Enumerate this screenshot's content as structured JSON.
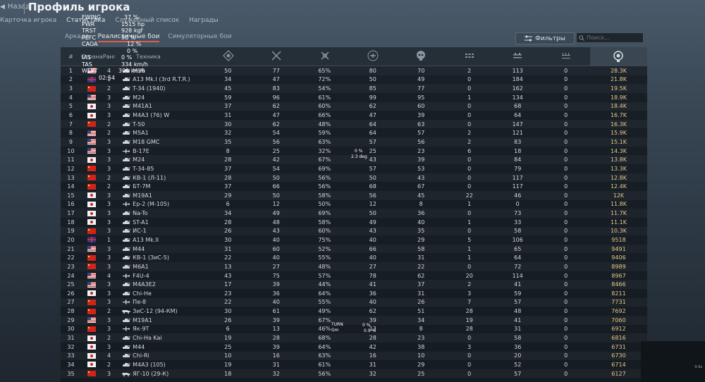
{
  "header": {
    "back_label": "Назад",
    "title": "Профиль игрока"
  },
  "tabs_main": [
    {
      "label": "Карточка игрока",
      "active": false
    },
    {
      "label": "Статистика",
      "active": true
    },
    {
      "label": "Служебный список",
      "active": false
    },
    {
      "label": "Награды",
      "active": false
    }
  ],
  "tabs_mode": [
    {
      "label": "Аркада",
      "active": false
    },
    {
      "label": "Реалистичные бои",
      "active": true
    },
    {
      "label": "Симуляторные бои",
      "active": false
    }
  ],
  "toolbar": {
    "filter_label": "Фильтры",
    "search_placeholder": "Поиск..."
  },
  "table": {
    "headers": {
      "num": "#",
      "country": "Страна",
      "rank": "Ранг",
      "vehicle": "Техника"
    },
    "stat_icons": [
      "battles-icon",
      "victories-icon",
      "win-rate-icon",
      "air-kills-icon",
      "ground-kills-icon",
      "stat6-icon",
      "stat7-icon",
      "stat8-icon",
      "research-icon"
    ],
    "rows": [
      {
        "n": "1",
        "c": "usa",
        "r": "4",
        "v": "M36",
        "t": "tank",
        "s": [
          "50",
          "77",
          "65%",
          "80",
          "70",
          "2",
          "113",
          "0",
          "28.3K"
        ]
      },
      {
        "n": "2",
        "c": "uk",
        "r": "1",
        "v": "A13 Mk.I (3rd R.T.R.)",
        "t": "tank",
        "s": [
          "34",
          "47",
          "72%",
          "50",
          "49",
          "0",
          "184",
          "0",
          "21.8K"
        ]
      },
      {
        "n": "3",
        "c": "china",
        "r": "2",
        "v": "T-34 (1940)",
        "t": "tank",
        "s": [
          "45",
          "83",
          "54%",
          "85",
          "77",
          "0",
          "162",
          "0",
          "19.5K"
        ]
      },
      {
        "n": "4",
        "c": "usa",
        "r": "3",
        "v": "M24",
        "t": "tank",
        "s": [
          "59",
          "96",
          "61%",
          "99",
          "95",
          "1",
          "134",
          "0",
          "18.9K"
        ]
      },
      {
        "n": "5",
        "c": "japan",
        "r": "3",
        "v": "M41A1",
        "t": "tank",
        "s": [
          "37",
          "62",
          "60%",
          "62",
          "60",
          "0",
          "68",
          "0",
          "18.4K"
        ]
      },
      {
        "n": "6",
        "c": "japan",
        "r": "3",
        "v": "M4A3 (76) W",
        "t": "tank",
        "s": [
          "31",
          "47",
          "66%",
          "47",
          "39",
          "0",
          "64",
          "0",
          "16.7K"
        ]
      },
      {
        "n": "7",
        "c": "china",
        "r": "2",
        "v": "T-50",
        "t": "tank",
        "s": [
          "30",
          "62",
          "48%",
          "64",
          "63",
          "0",
          "147",
          "0",
          "16.3K"
        ]
      },
      {
        "n": "8",
        "c": "usa",
        "r": "2",
        "v": "M5A1",
        "t": "tank",
        "s": [
          "32",
          "54",
          "59%",
          "64",
          "57",
          "2",
          "121",
          "0",
          "15.9K"
        ]
      },
      {
        "n": "9",
        "c": "usa",
        "r": "3",
        "v": "M18 GMC",
        "t": "tank",
        "s": [
          "35",
          "56",
          "63%",
          "57",
          "56",
          "2",
          "83",
          "0",
          "15.1K"
        ]
      },
      {
        "n": "10",
        "c": "usa",
        "r": "3",
        "v": "B-17E",
        "t": "plane",
        "s": [
          "8",
          "25",
          "32%",
          "25",
          "23",
          "6",
          "18",
          "0",
          "14.3K"
        ]
      },
      {
        "n": "11",
        "c": "japan",
        "r": "3",
        "v": "M24",
        "t": "tank",
        "s": [
          "28",
          "42",
          "67%",
          "43",
          "39",
          "0",
          "84",
          "0",
          "13.8K"
        ]
      },
      {
        "n": "12",
        "c": "china",
        "r": "3",
        "v": "T-34-85",
        "t": "tank",
        "s": [
          "37",
          "54",
          "69%",
          "57",
          "53",
          "0",
          "79",
          "0",
          "13.3K"
        ]
      },
      {
        "n": "13",
        "c": "china",
        "r": "2",
        "v": "КВ-1 (Л-11)",
        "t": "tank",
        "s": [
          "28",
          "50",
          "56%",
          "50",
          "43",
          "0",
          "117",
          "0",
          "12.8K"
        ]
      },
      {
        "n": "14",
        "c": "china",
        "r": "2",
        "v": "БТ-7М",
        "t": "tank",
        "s": [
          "37",
          "66",
          "56%",
          "68",
          "67",
          "0",
          "117",
          "0",
          "12.4K"
        ]
      },
      {
        "n": "15",
        "c": "japan",
        "r": "3",
        "v": "M19A1",
        "t": "tank",
        "s": [
          "29",
          "50",
          "58%",
          "56",
          "45",
          "22",
          "46",
          "0",
          "12K"
        ]
      },
      {
        "n": "16",
        "c": "japan",
        "r": "3",
        "v": "Ep-2 (M-105)",
        "t": "plane",
        "s": [
          "6",
          "12",
          "50%",
          "12",
          "8",
          "1",
          "0",
          "0",
          "11.8K"
        ]
      },
      {
        "n": "17",
        "c": "japan",
        "r": "3",
        "v": "Na-To",
        "t": "tank",
        "s": [
          "34",
          "49",
          "69%",
          "50",
          "36",
          "0",
          "73",
          "0",
          "11.7K"
        ]
      },
      {
        "n": "18",
        "c": "japan",
        "r": "3",
        "v": "ST-A1",
        "t": "tank",
        "s": [
          "28",
          "48",
          "58%",
          "49",
          "40",
          "1",
          "33",
          "0",
          "11.1K"
        ]
      },
      {
        "n": "19",
        "c": "china",
        "r": "3",
        "v": "ИС-1",
        "t": "tank",
        "s": [
          "26",
          "43",
          "60%",
          "43",
          "35",
          "0",
          "58",
          "0",
          "10.3K"
        ]
      },
      {
        "n": "20",
        "c": "uk",
        "r": "1",
        "v": "A13 Mk.II",
        "t": "tank",
        "s": [
          "30",
          "40",
          "75%",
          "40",
          "29",
          "5",
          "106",
          "0",
          "9518"
        ]
      },
      {
        "n": "21",
        "c": "usa",
        "r": "3",
        "v": "M44",
        "t": "tank",
        "s": [
          "31",
          "60",
          "52%",
          "66",
          "58",
          "1",
          "65",
          "0",
          "9491"
        ]
      },
      {
        "n": "22",
        "c": "china",
        "r": "3",
        "v": "КВ-1 (ЗиС-5)",
        "t": "tank",
        "s": [
          "22",
          "40",
          "55%",
          "40",
          "31",
          "1",
          "64",
          "0",
          "9406"
        ]
      },
      {
        "n": "23",
        "c": "china",
        "r": "3",
        "v": "M6A1",
        "t": "tank",
        "s": [
          "13",
          "27",
          "48%",
          "27",
          "22",
          "0",
          "72",
          "0",
          "8989"
        ]
      },
      {
        "n": "24",
        "c": "usa",
        "r": "4",
        "v": "F4U-4",
        "t": "plane",
        "s": [
          "43",
          "75",
          "57%",
          "78",
          "62",
          "20",
          "114",
          "0",
          "8967"
        ]
      },
      {
        "n": "25",
        "c": "usa",
        "r": "3",
        "v": "M4A3E2",
        "t": "tank",
        "s": [
          "17",
          "39",
          "44%",
          "41",
          "37",
          "2",
          "41",
          "0",
          "8466"
        ]
      },
      {
        "n": "26",
        "c": "japan",
        "r": "3",
        "v": "Chi-He",
        "t": "tank",
        "s": [
          "23",
          "36",
          "64%",
          "36",
          "31",
          "3",
          "59",
          "0",
          "8211"
        ]
      },
      {
        "n": "27",
        "c": "china",
        "r": "3",
        "v": "Пе-8",
        "t": "plane",
        "s": [
          "22",
          "40",
          "55%",
          "40",
          "26",
          "7",
          "57",
          "0",
          "7731"
        ]
      },
      {
        "n": "28",
        "c": "china",
        "r": "2",
        "v": "ЗиС-12 (94-КМ)",
        "t": "truck",
        "s": [
          "30",
          "61",
          "49%",
          "62",
          "51",
          "28",
          "48",
          "0",
          "7692"
        ]
      },
      {
        "n": "29",
        "c": "usa",
        "r": "3",
        "v": "M19A1",
        "t": "tank",
        "s": [
          "26",
          "39",
          "67%",
          "39",
          "34",
          "19",
          "41",
          "0",
          "7060"
        ]
      },
      {
        "n": "30",
        "c": "china",
        "r": "3",
        "v": "Як-9Т",
        "t": "plane",
        "s": [
          "6",
          "13",
          "46%",
          "13",
          "8",
          "28",
          "31",
          "0",
          "6912"
        ]
      },
      {
        "n": "31",
        "c": "japan",
        "r": "2",
        "v": "Chi-Ha Kai",
        "t": "tank",
        "s": [
          "19",
          "28",
          "68%",
          "28",
          "23",
          "0",
          "58",
          "0",
          "6816"
        ]
      },
      {
        "n": "32",
        "c": "japan",
        "r": "3",
        "v": "M44",
        "t": "tank",
        "s": [
          "25",
          "39",
          "64%",
          "42",
          "38",
          "3",
          "36",
          "0",
          "6731"
        ]
      },
      {
        "n": "33",
        "c": "japan",
        "r": "4",
        "v": "Chi-Ri",
        "t": "tank",
        "s": [
          "10",
          "16",
          "63%",
          "16",
          "10",
          "0",
          "20",
          "0",
          "6730"
        ]
      },
      {
        "n": "34",
        "c": "japan",
        "r": "2",
        "v": "M4A3 (105)",
        "t": "tank",
        "s": [
          "19",
          "31",
          "61%",
          "31",
          "29",
          "0",
          "52",
          "0",
          "6714"
        ]
      },
      {
        "n": "35",
        "c": "china",
        "r": "3",
        "v": "ЯГ-10 (29-К)",
        "t": "truck",
        "s": [
          "18",
          "32",
          "56%",
          "32",
          "25",
          "0",
          "57",
          "0",
          "6127"
        ]
      }
    ]
  },
  "overlay": {
    "left_labels": [
      "FWING",
      "PWR",
      "TRST",
      "PEFC",
      "CAOA",
      "IAS",
      "TAS",
      "WEPT"
    ],
    "right_values": [
      "37 %",
      "1515 hp",
      "928 kgf",
      "90 %",
      "12 %",
      "0 %",
      "0 %",
      "334 km/h",
      "399 km/h",
      "02:54"
    ],
    "mid_values": [
      "0 %",
      "2.3 deg"
    ],
    "turn_labels": [
      "TURN",
      "Gm"
    ],
    "turn_values": [
      "0 %",
      "0.9 %"
    ],
    "corner_value": "0.5s"
  }
}
